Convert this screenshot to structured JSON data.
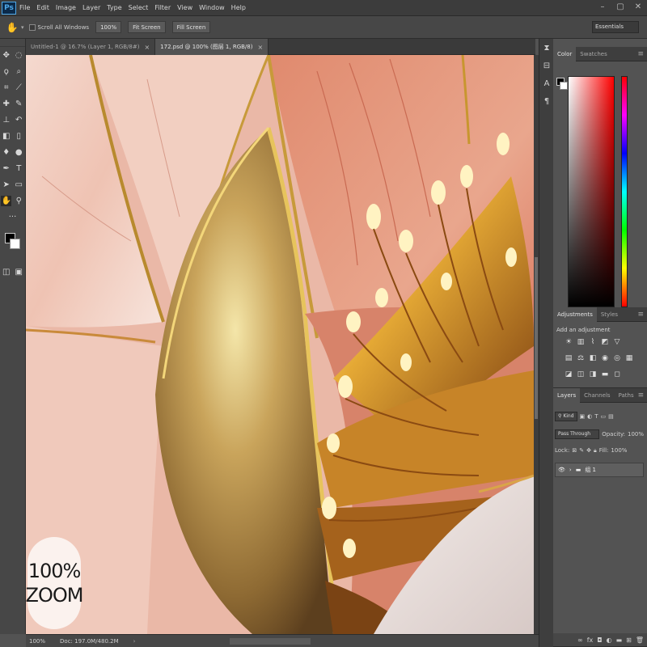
{
  "app": {
    "logo": "Ps"
  },
  "menu": {
    "items": [
      "File",
      "Edit",
      "Image",
      "Layer",
      "Type",
      "Select",
      "Filter",
      "View",
      "Window",
      "Help"
    ]
  },
  "window_controls": {
    "minimize": "–",
    "maximize": "▢",
    "close": "✕"
  },
  "options_bar": {
    "tool_icon": "hand-icon",
    "scroll_all_windows": "Scroll All Windows",
    "zoom_100": "100%",
    "fit_screen": "Fit Screen",
    "fill_screen": "Fill Screen",
    "workspace": "Essentials"
  },
  "document_tabs": [
    {
      "label": "Untitled-1 @ 16.7% (Layer 1, RGB/8#)",
      "active": false
    },
    {
      "label": "172.psd @ 100% (图层 1, RGB/8)",
      "active": true
    }
  ],
  "canvas": {
    "overlay_line1": "100%",
    "overlay_line2": "ZOOM"
  },
  "status_bar": {
    "zoom": "100%",
    "doc": "Doc: 197.0M/480.2M"
  },
  "panels": {
    "color": {
      "tabs": [
        "Color",
        "Swatches"
      ]
    },
    "adjustments": {
      "tabs": [
        "Adjustments",
        "Styles"
      ],
      "title": "Add an adjustment"
    },
    "layers": {
      "tabs": [
        "Layers",
        "Channels",
        "Paths"
      ],
      "kind_filter": "Kind",
      "blend_mode": "Pass Through",
      "opacity_label": "Opacity:",
      "opacity_value": "100%",
      "lock_label": "Lock:",
      "fill_label": "Fill:",
      "fill_value": "100%",
      "layer_name": "组 1"
    }
  },
  "colors": {
    "foreground": "#000000",
    "background": "#ffffff",
    "ui_dark": "#3c3c3c",
    "ui_mid": "#535353"
  }
}
